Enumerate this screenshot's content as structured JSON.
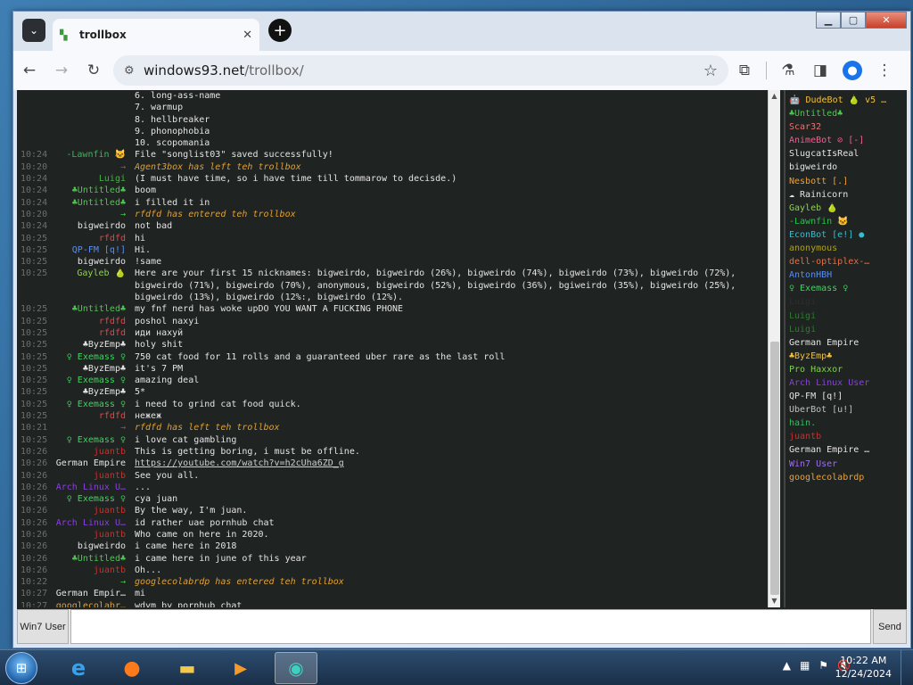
{
  "browser": {
    "tab_title": "trollbox",
    "tab_close": "✕",
    "url_host": "windows93.net",
    "url_path": "/trollbox/"
  },
  "chat": {
    "messages": [
      {
        "time": "",
        "nick": "",
        "nick_color": "#e4e4e4",
        "text": "6. long-ass-name",
        "type": "normal"
      },
      {
        "time": "",
        "nick": "",
        "nick_color": "#e4e4e4",
        "text": "7. warmup",
        "type": "normal"
      },
      {
        "time": "",
        "nick": "",
        "nick_color": "#e4e4e4",
        "text": "8. hellbreaker",
        "type": "normal"
      },
      {
        "time": "",
        "nick": "",
        "nick_color": "#e4e4e4",
        "text": "9. phonophobia",
        "type": "normal"
      },
      {
        "time": "",
        "nick": "",
        "nick_color": "#e4e4e4",
        "text": "10. scopomania",
        "type": "normal"
      },
      {
        "time": "10:24",
        "nick": "-Lawnfin 🐱",
        "nick_color": "#2fbf4f",
        "text": "File \"songlist03\" saved successfully!",
        "type": "normal"
      },
      {
        "time": "10:20",
        "nick": "→",
        "nick_color": "#d9383a",
        "text": "Agent3box has left teh trollbox",
        "type": "system"
      },
      {
        "time": "10:24",
        "nick": "Luigi",
        "nick_color": "#46b246",
        "text": "(I must have time, so i have time till tommarow to decisde.)",
        "type": "normal"
      },
      {
        "time": "10:24",
        "nick": "♣Untitled♣",
        "nick_color": "#4fc64f",
        "text": "boom",
        "type": "normal"
      },
      {
        "time": "10:24",
        "nick": "♣Untitled♣",
        "nick_color": "#4fc64f",
        "text": "i filled it in",
        "type": "normal"
      },
      {
        "time": "10:20",
        "nick": "→",
        "nick_color": "#3fcf3f",
        "text": "rfdfd has entered teh trollbox",
        "type": "system"
      },
      {
        "time": "10:24",
        "nick": "bigweirdo",
        "nick_color": "#e4e4e4",
        "text": "not bad",
        "type": "normal"
      },
      {
        "time": "10:25",
        "nick": "rfdfd",
        "nick_color": "#e2474a",
        "text": "hi",
        "type": "normal"
      },
      {
        "time": "10:25",
        "nick": "QP-FM [q!]",
        "nick_color": "#5b8ff0",
        "text": "Hi.",
        "type": "normal"
      },
      {
        "time": "10:25",
        "nick": "bigweirdo",
        "nick_color": "#e4e4e4",
        "text": "!same",
        "type": "normal"
      },
      {
        "time": "10:25",
        "nick": "Gayleb 🍐",
        "nick_color": "#8fd14f",
        "text": "Here are your first 15 nicknames: bigweirdo, bigweirdo (26%), bigweirdo (74%), bigweirdo (73%), bigweirdo (72%), bigweirdo (71%), bigweirdo (70%), anonymous, bigweirdo (52%), bigweirdo (36%), bgiweirdo (35%), bigweirdo (25%), bigweirdo (13%), bigweirdo (12%:, bigweirdo (12%).",
        "type": "normal"
      },
      {
        "time": "10:25",
        "nick": "♣Untitled♣",
        "nick_color": "#4fc64f",
        "text": "my fnf nerd has woke upDO YOU WANT A FUCKING PHONE",
        "type": "normal"
      },
      {
        "time": "10:25",
        "nick": "rfdfd",
        "nick_color": "#e2474a",
        "text": "poshol naxyi",
        "type": "normal"
      },
      {
        "time": "10:25",
        "nick": "rfdfd",
        "nick_color": "#e2474a",
        "text": "иди нахуй",
        "type": "normal"
      },
      {
        "time": "10:25",
        "nick": "♣ByzEmp♣",
        "nick_color": "#e4e4e4",
        "text": "holy shit",
        "type": "normal"
      },
      {
        "time": "10:25",
        "nick": "♀ Exemass ♀",
        "nick_color": "#3fd35f",
        "text": "750 cat food for 11 rolls and a guaranteed uber rare as the last roll",
        "type": "normal"
      },
      {
        "time": "10:25",
        "nick": "♣ByzEmp♣",
        "nick_color": "#e4e4e4",
        "text": "it's 7 PM",
        "type": "normal"
      },
      {
        "time": "10:25",
        "nick": "♀ Exemass ♀",
        "nick_color": "#3fd35f",
        "text": "amazing deal",
        "type": "normal"
      },
      {
        "time": "10:25",
        "nick": "♣ByzEmp♣",
        "nick_color": "#e4e4e4",
        "text": "5*",
        "type": "normal"
      },
      {
        "time": "10:25",
        "nick": "♀ Exemass ♀",
        "nick_color": "#3fd35f",
        "text": "i need to grind cat food quick.",
        "type": "normal"
      },
      {
        "time": "10:25",
        "nick": "rfdfd",
        "nick_color": "#e2474a",
        "text": "нежеж",
        "type": "normal"
      },
      {
        "time": "10:21",
        "nick": "→",
        "nick_color": "#d9383a",
        "text": "rfdfd has left teh trollbox",
        "type": "system"
      },
      {
        "time": "10:25",
        "nick": "♀ Exemass ♀",
        "nick_color": "#3fd35f",
        "text": "i love cat gambling",
        "type": "normal"
      },
      {
        "time": "10:26",
        "nick": "juantb",
        "nick_color": "#c9302c",
        "text": "This is getting boring, i must be offline.",
        "type": "normal"
      },
      {
        "time": "10:26",
        "nick": "German Empire",
        "nick_color": "#e4e4e4",
        "text": "https://youtube.com/watch?v=h2cUha6ZD_g",
        "type": "link"
      },
      {
        "time": "10:26",
        "nick": "juantb",
        "nick_color": "#c9302c",
        "text": "See you all.",
        "type": "normal"
      },
      {
        "time": "10:26",
        "nick": "Arch Linux U…",
        "nick_color": "#8a3fe0",
        "text": "...",
        "type": "normal"
      },
      {
        "time": "10:26",
        "nick": "♀ Exemass ♀",
        "nick_color": "#3fd35f",
        "text": "cya juan",
        "type": "normal"
      },
      {
        "time": "10:26",
        "nick": "juantb",
        "nick_color": "#c9302c",
        "text": "By the way, I'm juan.",
        "type": "normal"
      },
      {
        "time": "10:26",
        "nick": "Arch Linux U…",
        "nick_color": "#8a3fe0",
        "text": "id rather uae pornhub chat",
        "type": "normal"
      },
      {
        "time": "10:26",
        "nick": "juantb",
        "nick_color": "#c9302c",
        "text": "Who came on here in 2020.",
        "type": "normal"
      },
      {
        "time": "10:26",
        "nick": "bigweirdo",
        "nick_color": "#e4e4e4",
        "text": "i came here in 2018",
        "type": "normal"
      },
      {
        "time": "10:26",
        "nick": "♣Untitled♣",
        "nick_color": "#4fc64f",
        "text": "i came here in june of this year",
        "type": "normal"
      },
      {
        "time": "10:26",
        "nick": "juantb",
        "nick_color": "#c9302c",
        "text": "Oh...",
        "type": "normal"
      },
      {
        "time": "10:22",
        "nick": "→",
        "nick_color": "#3fcf3f",
        "text": "googlecolabrdp has entered teh trollbox",
        "type": "system"
      },
      {
        "time": "10:27",
        "nick": "German Empir…",
        "nick_color": "#e4e4e4",
        "text": "mi",
        "type": "normal"
      },
      {
        "time": "10:27",
        "nick": "googlecolabr…",
        "nick_color": "#e0a033",
        "text": "wdym by pornhub chat",
        "type": "normal"
      }
    ]
  },
  "users": [
    {
      "name": "🤖 DudeBot 🍐 v5 …",
      "color": "#f0c040"
    },
    {
      "name": "♣Untitled♣",
      "color": "#4fc64f"
    },
    {
      "name": "Scar32",
      "color": "#f07070"
    },
    {
      "name": "AnimeBot ⊘ [-]",
      "color": "#f06090"
    },
    {
      "name": "SlugcatIsReal",
      "color": "#e4e4e4"
    },
    {
      "name": "bigweirdo",
      "color": "#e4e4e4"
    },
    {
      "name": "Nesbott [.]",
      "color": "#f0a030"
    },
    {
      "name": "☁ Rainicorn",
      "color": "#e4e4e4"
    },
    {
      "name": "Gayleb 🍐",
      "color": "#8fd14f"
    },
    {
      "name": "-Lawnfin 🐱",
      "color": "#2fbf4f"
    },
    {
      "name": "EconBot [e!] ●",
      "color": "#30c0d0"
    },
    {
      "name": "anonymous",
      "color": "#b0a020"
    },
    {
      "name": "dell-optiplex-…",
      "color": "#f06a3a"
    },
    {
      "name": "AntonHBH",
      "color": "#5a8df0"
    },
    {
      "name": "♀ Exemass ♀",
      "color": "#3fd35f"
    },
    {
      "name": "Luigi",
      "color": "#2e2e2e"
    },
    {
      "name": "Luigi",
      "color": "#2f7a2f"
    },
    {
      "name": "Luigi",
      "color": "#2f7a2f"
    },
    {
      "name": "German Empire",
      "color": "#e4e4e4"
    },
    {
      "name": "♣ByzEmp♣",
      "color": "#f0c040"
    },
    {
      "name": "Pro Haxxor",
      "color": "#7fd14f"
    },
    {
      "name": "Arch Linux User",
      "color": "#8a3fe0"
    },
    {
      "name": "QP-FM [q!]",
      "color": "#e4e4e4"
    },
    {
      "name": "UberBot [u!]",
      "color": "#c0c0c0"
    },
    {
      "name": "hain.",
      "color": "#30c060"
    },
    {
      "name": "juantb",
      "color": "#c9302c"
    },
    {
      "name": "German Empire …",
      "color": "#e4e4e4"
    },
    {
      "name": "Win7 User",
      "color": "#a06cf0"
    },
    {
      "name": "googlecolabrdp",
      "color": "#f0a030"
    }
  ],
  "input": {
    "nick_label": "Win7 User",
    "message_placeholder": "",
    "send_label": "Send"
  },
  "taskbar": {
    "time": "10:22 AM",
    "date": "12/24/2024"
  }
}
